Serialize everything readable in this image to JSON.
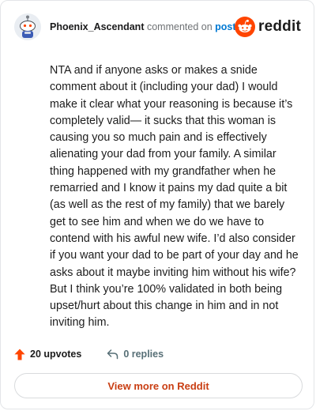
{
  "header": {
    "username": "Phoenix_Ascendant",
    "action_text": "commented on",
    "target_link": "post",
    "brand_name": "reddit"
  },
  "comment": {
    "body": "NTA and if anyone asks or makes a snide comment about it (including your dad) I would make it clear what your reasoning is because it’s completely valid— it sucks that this woman is causing you so much pain and is effectively alienating your dad from your family. A similar thing happened with my grandfather when he remarried and I know it pains my dad quite a bit (as well as the rest of my family) that we barely get to see him and when we do we have to contend with his awful new wife. I’d also consider if you want your dad to be part of your day and he asks about it maybe inviting him without his wife? But I think you’re 100% validated in both being upset/hurt about this change in him and in not inviting him."
  },
  "actions": {
    "upvotes_label": "20 upvotes",
    "replies_label": "0 replies"
  },
  "footer": {
    "view_more_label": "View more on Reddit"
  },
  "icons": {
    "avatar": "snoo-avatar-icon",
    "brand": "reddit-logo-icon",
    "upvote": "upvote-arrow-icon",
    "reply": "reply-arrow-icon"
  },
  "colors": {
    "brand_orange": "#ff4500",
    "link_blue": "#0079d3",
    "view_more_text": "#c93e13",
    "border": "#e3e5e8"
  }
}
